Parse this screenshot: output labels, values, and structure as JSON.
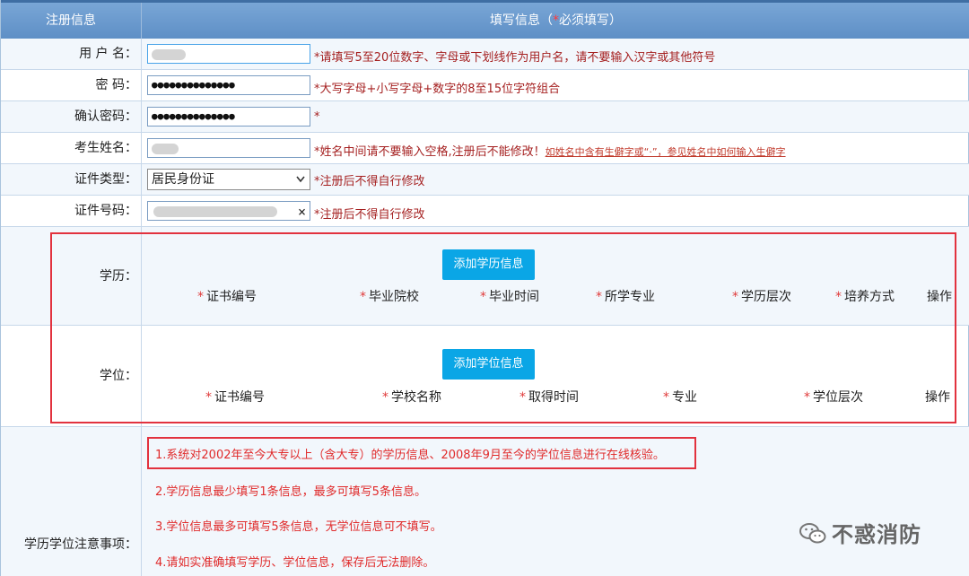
{
  "header": {
    "col1": "注册信息",
    "col2_prefix": "填写信息（",
    "col2_star": "*",
    "col2_suffix": "必须填写）"
  },
  "fields": {
    "username": {
      "label": "用 户 名：",
      "value": "",
      "hint": "*请填写5至20位数字、字母或下划线作为用户名，请不要输入汉字或其他符号"
    },
    "password": {
      "label": "密      码：",
      "value": "●●●●●●●●●●●●●●",
      "hint": "*大写字母+小写字母+数字的8至15位字符组合"
    },
    "confirm_password": {
      "label": "确认密码：",
      "value": "●●●●●●●●●●●●●●",
      "hint": "*"
    },
    "name": {
      "label": "考生姓名：",
      "value": "",
      "hint": "*姓名中间请不要输入空格,注册后不能修改！",
      "hint_link": "如姓名中含有生僻字或“·”，参见姓名中如何输入生僻字"
    },
    "id_type": {
      "label": "证件类型：",
      "value": "居民身份证",
      "hint": "*注册后不得自行修改"
    },
    "id_number": {
      "label": "证件号码：",
      "value": "",
      "clear": "×",
      "hint": "*注册后不得自行修改"
    }
  },
  "education": {
    "label": "学历：",
    "button": "添加学历信息",
    "columns": [
      "证书编号",
      "毕业院校",
      "毕业时间",
      "所学专业",
      "学历层次",
      "培养方式"
    ],
    "action": "操作",
    "star": "*"
  },
  "degree": {
    "label": "学位：",
    "button": "添加学位信息",
    "columns": [
      "证书编号",
      "学校名称",
      "取得时间",
      "专业",
      "学位层次"
    ],
    "action": "操作",
    "star": "*"
  },
  "notes": {
    "label": "学历学位注意事项：",
    "items": [
      "1.系统对2002年至今大专以上（含大专）的学历信息、2008年9月至今的学位信息进行在线核验。",
      "2.学历信息最少填写1条信息，最多可填写5条信息。",
      "3.学位信息最多可填写5条信息，无学位信息可不填写。",
      "4.请如实准确填写学历、学位信息，保存后无法删除。"
    ]
  },
  "watermark": {
    "text": "不惑消防",
    "icon": "wechat-icon"
  },
  "colors": {
    "header": "#6b9bd0",
    "hint": "#a52020",
    "note": "#e02a2a",
    "button": "#0aa6e6",
    "highlight_border": "#e2323e"
  }
}
